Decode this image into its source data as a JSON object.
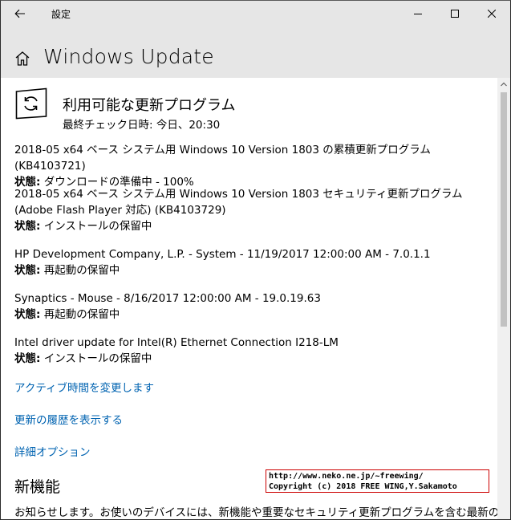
{
  "titlebar": {
    "title": "設定",
    "back_icon": "back-arrow-icon",
    "minimize_icon": "minimize-icon",
    "maximize_icon": "maximize-icon",
    "close_icon": "close-icon"
  },
  "header": {
    "home_icon": "home-icon",
    "page_title": "Windows Update"
  },
  "status": {
    "icon": "update-sync-icon",
    "heading": "利用可能な更新プログラム",
    "last_check": "最終チェック日時: 今日、20:30"
  },
  "updates": [
    {
      "name": "2018-05 x64 ベース システム用 Windows 10 Version 1803 の累積更新プログラム (KB4103721)",
      "status_label": "状態:",
      "status_value": " ダウンロードの準備中 - 100%"
    },
    {
      "name": "2018-05 x64 ベース システム用 Windows 10 Version 1803 セキュリティ更新プログラム (Adobe Flash Player 対応) (KB4103729)",
      "status_label": "状態:",
      "status_value": " インストールの保留中"
    },
    {
      "name": "HP Development Company, L.P. - System - 11/19/2017 12:00:00 AM - 7.0.1.1",
      "status_label": "状態:",
      "status_value": " 再起動の保留中"
    },
    {
      "name": "Synaptics - Mouse - 8/16/2017 12:00:00 AM - 19.0.19.63",
      "status_label": "状態:",
      "status_value": " 再起動の保留中"
    },
    {
      "name": "Intel driver update for Intel(R) Ethernet Connection I218-LM",
      "status_label": "状態:",
      "status_value": " インストールの保留中"
    }
  ],
  "links": {
    "active_hours": "アクティブ時間を変更します",
    "history": "更新の履歴を表示する",
    "advanced": "詳細オプション"
  },
  "whats_new": {
    "title": "新機能",
    "description": "お知らせします。お使いのデバイスには、新機能や重要なセキュリティ更新プログラムを含む最新の"
  },
  "watermark": {
    "line1": "http://www.neko.ne.jp/~freewing/",
    "line2": "Copyright (c) 2018 FREE WING,Y.Sakamoto"
  },
  "colors": {
    "link": "#0063b1",
    "chrome": "#e6e6e6",
    "watermark_border": "#cc0000"
  }
}
